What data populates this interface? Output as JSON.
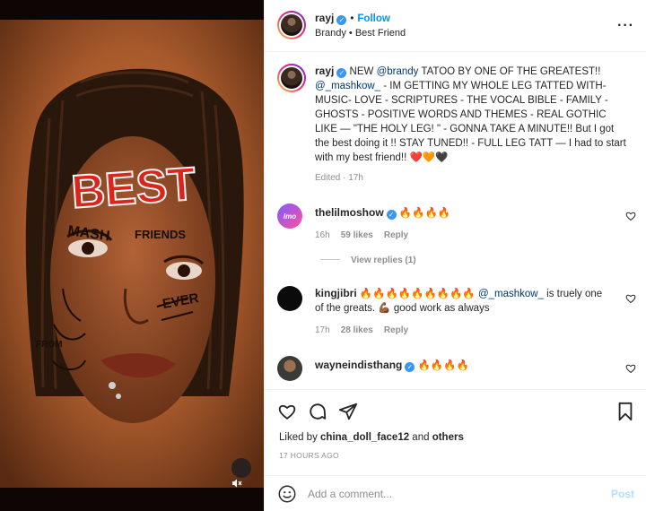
{
  "post": {
    "username": "rayj",
    "follow_label": "Follow",
    "subtitle": "Brandy • Best Friend",
    "more_icon": "more-horizontal-icon"
  },
  "media": {
    "alt": "tattoo of a woman's face with braids",
    "face_text_best": "BEST",
    "face_text_friends": "FRIENDS",
    "face_text_mash": "MASH",
    "face_text_ever": "EVER",
    "face_text_from": "FROM",
    "mute_icon": "volume-muted-icon"
  },
  "caption": {
    "username": "rayj",
    "parts": {
      "p1": " NEW ",
      "mention1": "@brandy",
      "p2": " TATOO BY ONE OF THE GREATEST!! ",
      "mention2": "@_mashkow_",
      "p3": " - IM GETTING MY WHOLE LEG TATTED WITH- MUSIC- LOVE - SCRIPTURES - THE VOCAL BIBLE - FAMILY - GHOSTS - POSITIVE WORDS AND THEMES - REAL GOTHIC LIKE — \"THE HOLY LEG! \" - GONNA TAKE A MINUTE!! But I got the best doing it !! STAY TUNED!! - FULL LEG TATT — I had to start with my best friend!! ❤️🧡🖤"
    },
    "edited": "Edited · 17h"
  },
  "comments": [
    {
      "username": "thelilmoshow",
      "text": " 🔥🔥🔥🔥",
      "time": "16h",
      "likes": "59 likes",
      "reply": "Reply",
      "view_replies": "View replies (1)"
    },
    {
      "username": "kingjibri",
      "text_pre": " 🔥🔥🔥🔥🔥🔥🔥🔥🔥 ",
      "mention": "@_mashkow_",
      "text_post": " is truely one of the greats. 💪🏾 good work as always",
      "time": "17h",
      "likes": "28 likes",
      "reply": "Reply"
    },
    {
      "username": "wayneindisthang",
      "text": " 🔥🔥🔥🔥"
    }
  ],
  "actions": {
    "like_icon": "heart-icon",
    "comment_icon": "comment-icon",
    "share_icon": "send-icon",
    "save_icon": "bookmark-icon"
  },
  "likes": {
    "prefix": "Liked by ",
    "user": "china_doll_face12",
    "middle": " and ",
    "others": "others",
    "time": "17 HOURS AGO"
  },
  "composer": {
    "placeholder": "Add a comment...",
    "post_label": "Post",
    "emoji_icon": "emoji-icon"
  },
  "colors": {
    "accent": "#0095f6",
    "mention": "#00376b",
    "muted": "#8e8e8e",
    "post_disabled": "#b2dffc"
  }
}
